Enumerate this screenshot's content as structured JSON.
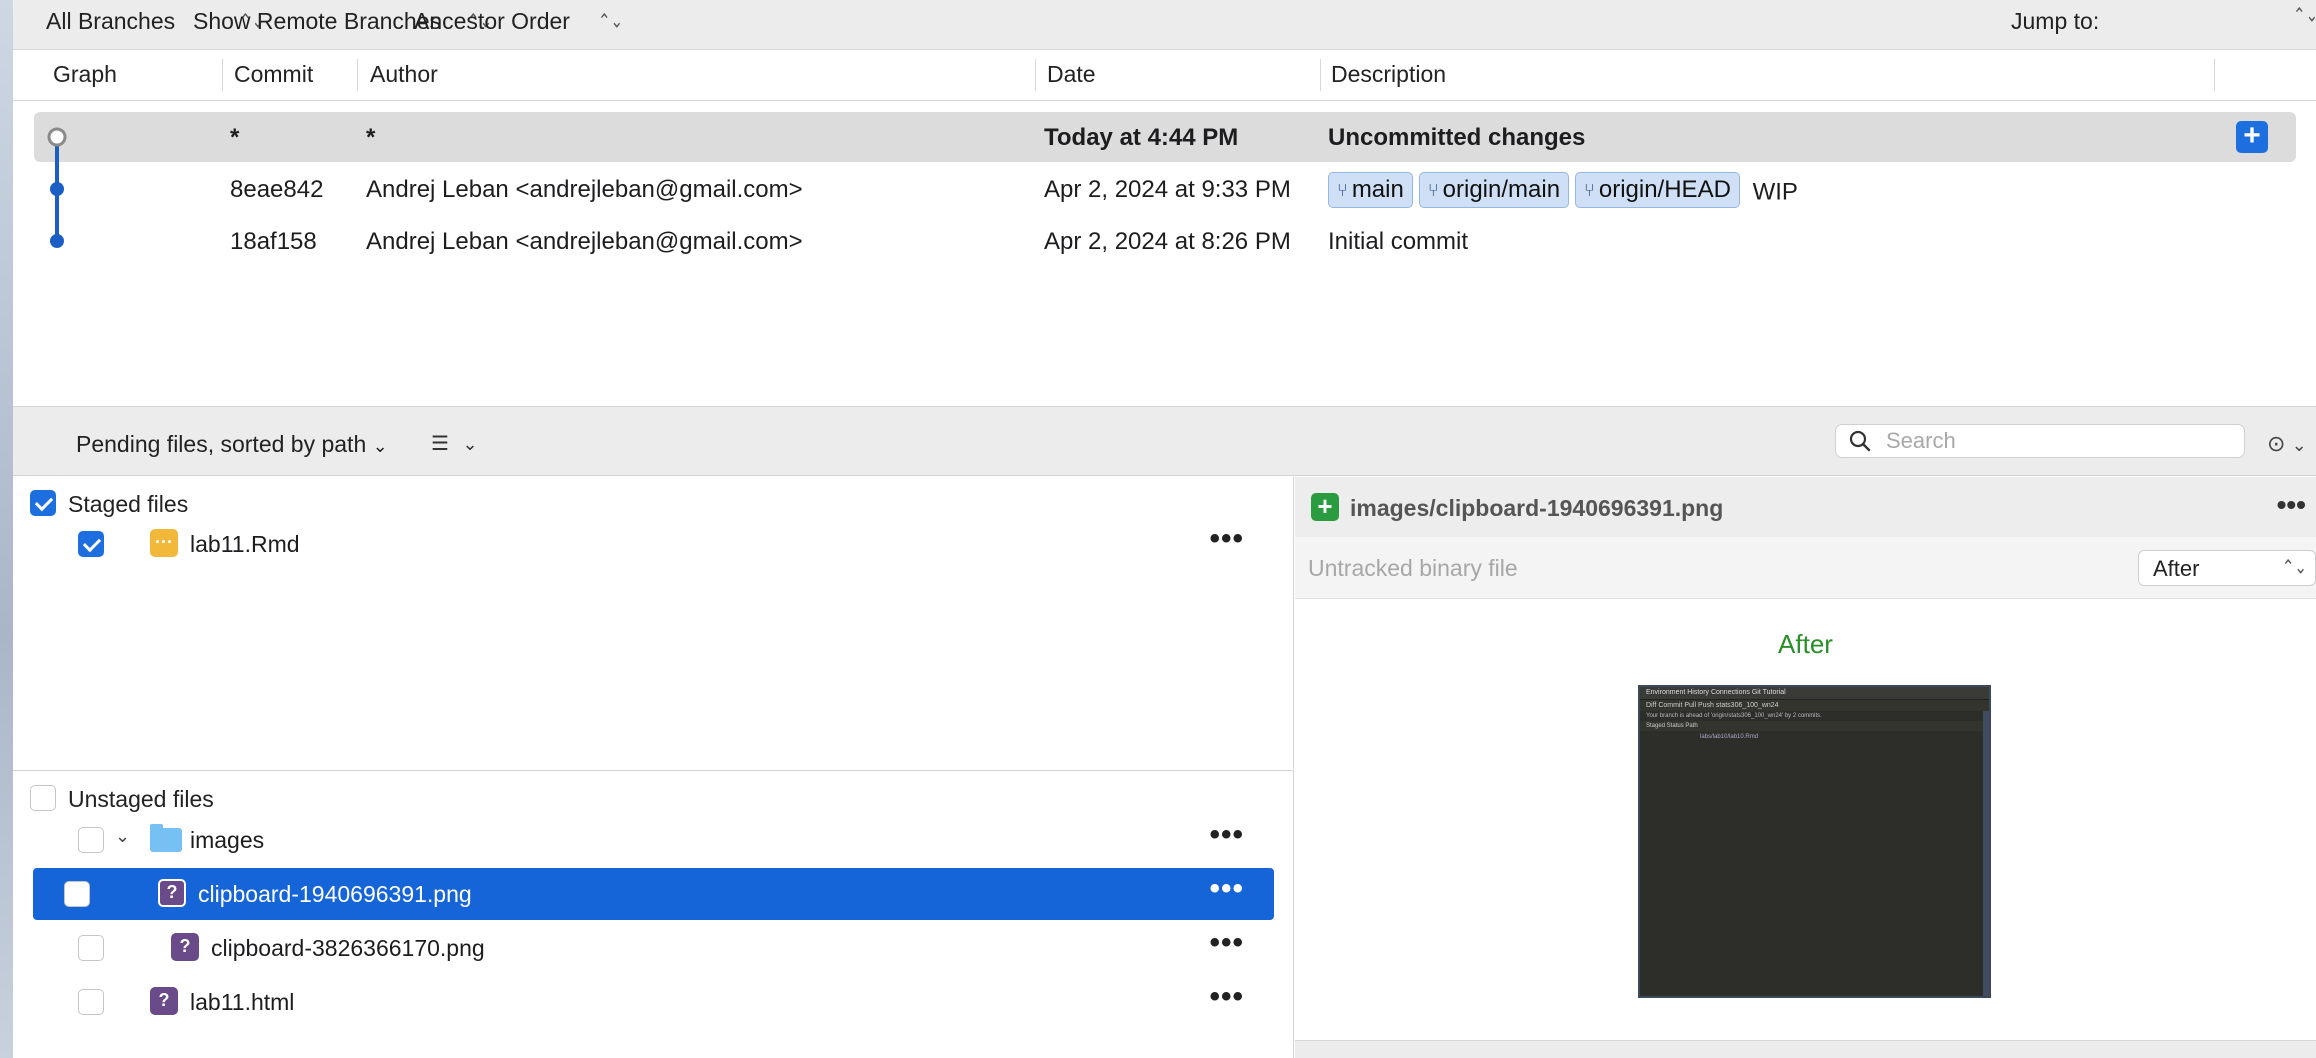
{
  "toolbar": {
    "branches": "All Branches",
    "remote": "Show Remote Branches",
    "order": "Ancestor Order",
    "jump_to": "Jump to:"
  },
  "columns": {
    "graph": "Graph",
    "commit": "Commit",
    "author": "Author",
    "date": "Date",
    "description": "Description"
  },
  "commits": [
    {
      "commit": "*",
      "author": "*",
      "date": "Today at 4:44 PM",
      "description": "Uncommitted changes"
    },
    {
      "commit": "8eae842",
      "author": "Andrej Leban <andrejleban@gmail.com>",
      "date": "Apr 2, 2024 at 9:33 PM",
      "tags": [
        "main",
        "origin/main",
        "origin/HEAD"
      ],
      "description": "WIP"
    },
    {
      "commit": "18af158",
      "author": "Andrej Leban <andrejleban@gmail.com>",
      "date": "Apr 2, 2024 at 8:26 PM",
      "description": "Initial commit"
    }
  ],
  "pending": {
    "sort_label": "Pending files, sorted by path",
    "search_placeholder": "Search"
  },
  "staged": {
    "title": "Staged files",
    "checked": true,
    "files": [
      {
        "name": "lab11.Rmd",
        "status": "modified",
        "checked": true
      }
    ]
  },
  "unstaged": {
    "title": "Unstaged files",
    "checked": false,
    "folder": {
      "name": "images",
      "expanded": true
    },
    "files": [
      {
        "name": "clipboard-1940696391.png",
        "status": "untracked",
        "selected": true
      },
      {
        "name": "clipboard-3826366170.png",
        "status": "untracked"
      },
      {
        "name": "lab11.html",
        "status": "untracked"
      }
    ]
  },
  "diff": {
    "path": "images/clipboard-1940696391.png",
    "subtitle": "Untracked binary file",
    "mode": "After",
    "image_label": "After",
    "thumbnail": {
      "tabs": "Environment   History   Connections   Git   Tutorial",
      "tools": "Diff   Commit   Pull   Push   stats306_100_wn24",
      "message": "Your branch is ahead of 'origin/stats306_100_wn24' by 2 commits.",
      "header": "Staged   Status   Path",
      "row": "labs/lab10/lab10.Rmd"
    }
  },
  "colors": {
    "accent": "#1d6fe0",
    "selection": "#1565d8",
    "tag_bg": "#cfe0f6",
    "added": "#2a9c3f",
    "untracked": "#6a4a88",
    "modified": "#f1b83a"
  }
}
